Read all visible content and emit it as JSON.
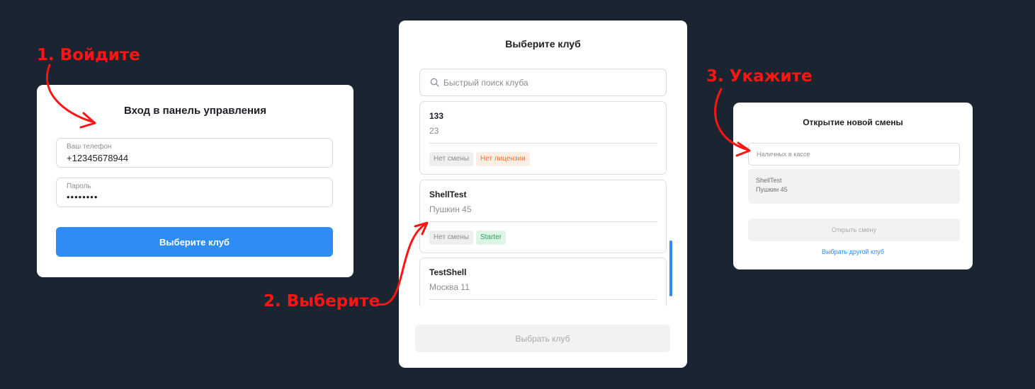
{
  "steps": {
    "step1": "1. Войдите",
    "step2": "2. Выберите",
    "step3": "3. Укажите"
  },
  "login": {
    "title": "Вход в панель управления",
    "phone": {
      "label": "Ваш телефон",
      "value": "+12345678944"
    },
    "password": {
      "label": "Пароль",
      "value": "••••••••"
    },
    "submit_label": "Выберите клуб"
  },
  "club_select": {
    "title": "Выберите клуб",
    "search_placeholder": "Быстрый поиск клуба",
    "clubs": [
      {
        "name": "133",
        "address": "23",
        "tags": [
          {
            "label": "Нет смены",
            "style": "gray"
          },
          {
            "label": "Нет лицензии",
            "style": "orange"
          }
        ]
      },
      {
        "name": "ShellTest",
        "address": "Пушкин 45",
        "tags": [
          {
            "label": "Нет смены",
            "style": "gray"
          },
          {
            "label": "Starter",
            "style": "green"
          }
        ]
      },
      {
        "name": "TestShell",
        "address": "Москва 11",
        "tags": []
      }
    ],
    "submit_label": "Выбрать клуб"
  },
  "shift": {
    "title": "Открытие новой смены",
    "cash_placeholder": "Наличных в кассе",
    "selected_club": {
      "name": "ShellTest",
      "address": "Пушкин 45"
    },
    "open_label": "Открыть смену",
    "other_club_link": "Выбрать другой клуб"
  },
  "colors": {
    "background": "#1b2431",
    "accent": "#2f8cf7",
    "annotation": "#ff1414"
  }
}
